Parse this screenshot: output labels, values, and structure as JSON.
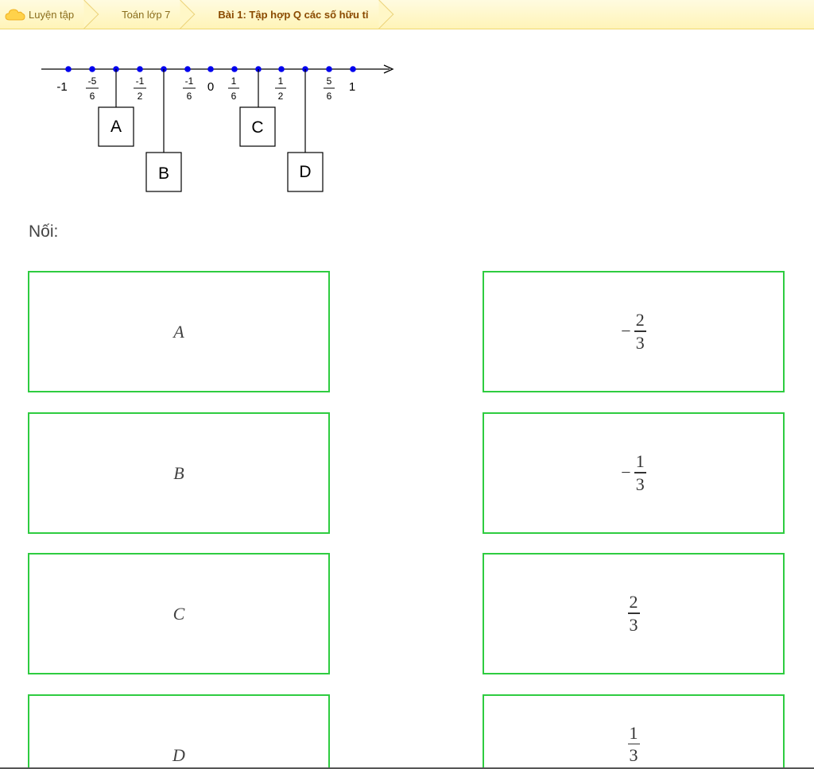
{
  "breadcrumb": {
    "items": [
      {
        "label": "Luyện tập"
      },
      {
        "label": "Toán lớp 7"
      },
      {
        "label": "Bài 1: Tập hợp Q các số hữu tỉ"
      }
    ]
  },
  "number_line": {
    "tick_labels": [
      {
        "whole": "-1"
      },
      {
        "num": "-5",
        "den": "6"
      },
      {
        "num": "-1",
        "den": "2"
      },
      {
        "num": "-1",
        "den": "6"
      },
      {
        "whole": "0"
      },
      {
        "num": "1",
        "den": "6"
      },
      {
        "num": "1",
        "den": "2"
      },
      {
        "num": "5",
        "den": "6"
      },
      {
        "whole": "1"
      }
    ],
    "boxes": {
      "a": "A",
      "b": "B",
      "c": "C",
      "d": "D"
    }
  },
  "prompt": "Nối:",
  "left_cards": [
    "A",
    "B",
    "C",
    "D"
  ],
  "right_cards": [
    {
      "sign": "−",
      "num": "2",
      "den": "3"
    },
    {
      "sign": "−",
      "num": "1",
      "den": "3"
    },
    {
      "sign": "",
      "num": "2",
      "den": "3"
    },
    {
      "sign": "",
      "num": "1",
      "den": "3"
    }
  ],
  "colors": {
    "card_border": "#2ecc40",
    "point": "#0000ee",
    "breadcrumb_bg": "#fff4b8"
  }
}
